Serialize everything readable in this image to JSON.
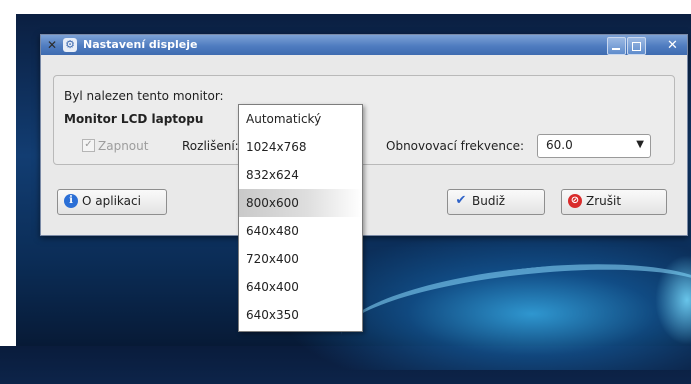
{
  "window": {
    "title": "Nastavení displeje"
  },
  "monitor": {
    "found_label": "Byl nalezen tento monitor:",
    "name": "Monitor LCD laptopu",
    "enable_label": "Zapnout",
    "enabled": true,
    "resolution_label": "Rozlišení:",
    "refresh_label": "Obnovovací frekvence:",
    "refresh_value": "60.0"
  },
  "resolution_menu": {
    "options": [
      "Automatický",
      "1024x768",
      "832x624",
      "800x600",
      "640x480",
      "720x400",
      "640x400",
      "640x350"
    ],
    "highlighted": "800x600"
  },
  "buttons": {
    "about": "O aplikaci",
    "ok": "Budiž",
    "cancel": "Zrušit"
  },
  "icons": {
    "app": "tools-icon",
    "menu": "gear-icon",
    "about": "info-icon",
    "ok": "checkmark-icon",
    "cancel": "cancel-icon"
  }
}
